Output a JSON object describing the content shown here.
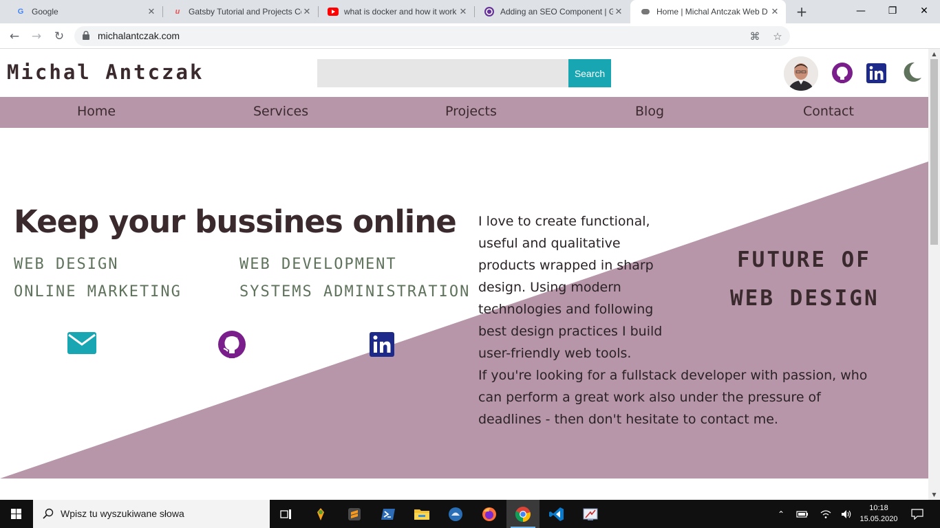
{
  "browser": {
    "tabs": [
      {
        "title": "Google",
        "favicon": "google-icon"
      },
      {
        "title": "Gatsby Tutorial and Projects Co",
        "favicon": "udemy-icon"
      },
      {
        "title": "what is docker and how it work",
        "favicon": "youtube-icon"
      },
      {
        "title": "Adding an SEO Component | G",
        "favicon": "gatsby-icon"
      },
      {
        "title": "Home | Michal Antczak Web D",
        "favicon": "site-icon",
        "active": true
      }
    ],
    "url": "michalantczak.com"
  },
  "site": {
    "brand": "Michal Antczak",
    "search": {
      "placeholder": "",
      "button": "Search"
    },
    "nav": [
      "Home",
      "Services",
      "Projects",
      "Blog",
      "Contact"
    ],
    "hero": {
      "headline": "Keep your bussines online",
      "services": [
        "WEB DESIGN",
        "WEB DEVELOPMENT",
        "ONLINE MARKETING",
        "SYSTEMS ADMINISTRATION"
      ],
      "about_lines_1": [
        "I love to create functional,",
        "useful and qualitative",
        "products wrapped in sharp",
        "design. Using modern",
        "technologies and following",
        "best design practices I build",
        "user-friendly web tools."
      ],
      "about_lines_2": [
        "If you're looking for a fullstack developer with passion, who",
        "can perform a great work also under the pressure of",
        "deadlines - then don't hesitate to contact me."
      ],
      "future_line1": "FUTURE OF",
      "future_line2": "WEB DESIGN"
    },
    "colors": {
      "accent": "#b896aa",
      "teal": "#17a6b2",
      "purple": "#7a1e8c",
      "navy": "#1d2a8a",
      "moss": "#5f735c",
      "dark": "#3a2a2e"
    }
  },
  "taskbar": {
    "search_placeholder": "Wpisz tu wyszukiwane słowa",
    "time": "10:18",
    "date": "15.05.2020"
  }
}
